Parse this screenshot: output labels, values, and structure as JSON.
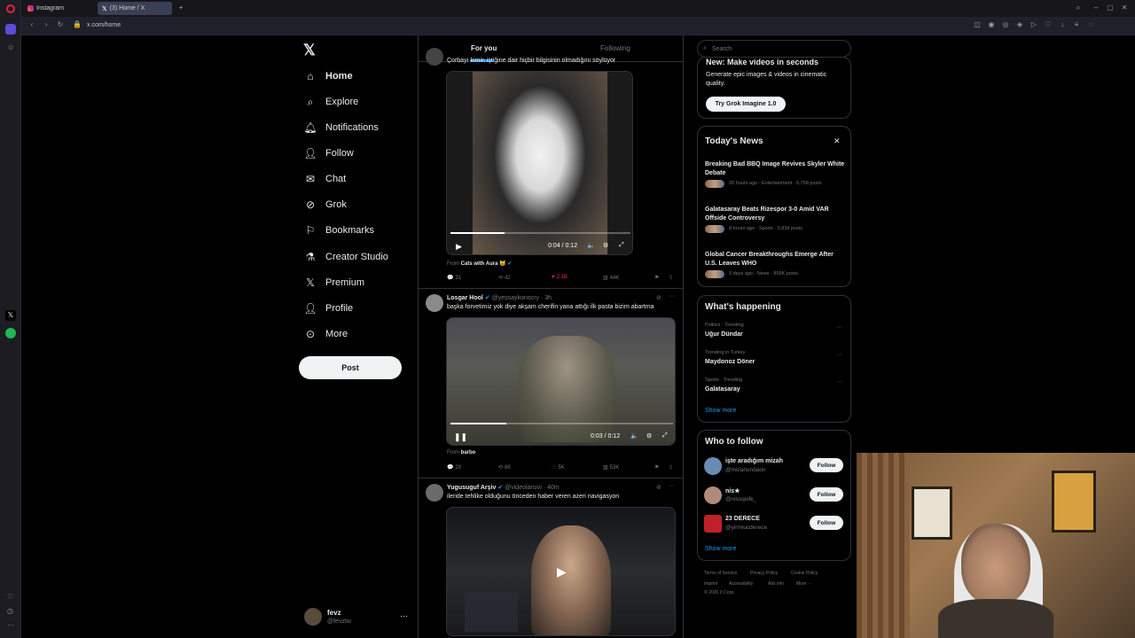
{
  "browser": {
    "tabs": [
      {
        "label": "Instagram"
      },
      {
        "label": "(3) Home / X"
      }
    ],
    "url": "x.com/home"
  },
  "nav": {
    "items": [
      {
        "label": "Home",
        "icon": "home-icon"
      },
      {
        "label": "Explore",
        "icon": "search-icon"
      },
      {
        "label": "Notifications",
        "icon": "bell-icon"
      },
      {
        "label": "Follow",
        "icon": "person-plus-icon"
      },
      {
        "label": "Chat",
        "icon": "envelope-icon"
      },
      {
        "label": "Grok",
        "icon": "grok-icon"
      },
      {
        "label": "Bookmarks",
        "icon": "bookmark-icon"
      },
      {
        "label": "Creator Studio",
        "icon": "flask-icon"
      },
      {
        "label": "Premium",
        "icon": "x-icon"
      },
      {
        "label": "Profile",
        "icon": "person-icon"
      },
      {
        "label": "More",
        "icon": "more-circle-icon"
      }
    ],
    "post_label": "Post",
    "account": {
      "name": "fevz",
      "handle": "@fevztw"
    }
  },
  "feed": {
    "tabs": {
      "for_you": "For you",
      "following": "Following"
    },
    "post1": {
      "text": "Çorbayı kimin içtiğine dair hiçbir bilgisinin olmadığını söylüyor",
      "video_time": "0:04 / 0:12",
      "video_progress": 0.3,
      "from_label": "From",
      "from_name": "Cats with Aura 😺",
      "replies": "31",
      "reposts": "42",
      "likes": "2.1B",
      "views": "44K"
    },
    "post2": {
      "name": "Losgar Hool",
      "handle": "@yessaykonocry · 3h",
      "text": "başka forvetimiz yok diye akşam cherifin yana attığı ilk pasta bizim abartma",
      "video_time": "0:03 / 0:12",
      "video_progress": 0.25,
      "from_label": "From",
      "from_name": "barbo",
      "replies": "20",
      "reposts": "88",
      "likes": "5K",
      "views": "53K"
    },
    "post3": {
      "name": "Yugusuguf Arşiv",
      "handle": "@videolarsivi · 40m",
      "text": "ileride tehlike olduğunu önceden haber veren azeri navigasyon"
    }
  },
  "sidebar": {
    "search_placeholder": "Search",
    "promo": {
      "title": "New: Make videos in seconds",
      "body": "Generate epic images & videos in cinematic quality.",
      "button": "Try Grok Imagine 1.0"
    },
    "news": {
      "title": "Today's News",
      "items": [
        {
          "headline": "Breaking Bad BBQ Image Revives Skyler White Debate",
          "meta": "20 hours ago · Entertainment · 5,758 posts"
        },
        {
          "headline": "Galatasaray Beats Rizespor 3-0 Amid VAR Offside Controversy",
          "meta": "8 hours ago · Sports · 5,834 posts"
        },
        {
          "headline": "Global Cancer Breakthroughs Emerge After U.S. Leaves WHO",
          "meta": "3 days ago · News · 855K posts"
        }
      ]
    },
    "happening": {
      "title": "What's happening",
      "items": [
        {
          "context": "Politics · Trending",
          "topic": "Uğur Dündar"
        },
        {
          "context": "Trending in Turkey",
          "topic": "Maydonoz Döner"
        },
        {
          "context": "Sports · Trending",
          "topic": "Galatasaray"
        }
      ],
      "show_more": "Show more"
    },
    "who_to_follow": {
      "title": "Who to follow",
      "items": [
        {
          "name": "işte aradığım mizah",
          "handle": "@mizahondaon",
          "button": "Follow"
        },
        {
          "name": "nis★",
          "handle": "@nissquilk_",
          "button": "Follow"
        },
        {
          "name": "23 DERECE",
          "handle": "@yirmiucderece",
          "button": "Follow"
        }
      ],
      "show_more": "Show more"
    },
    "footer": {
      "links": [
        "Terms of Service",
        "Privacy Policy",
        "Cookie Policy",
        "Imprint",
        "Accessibility",
        "Ads info",
        "More ···"
      ],
      "copyright": "© 2026 X Corp."
    }
  },
  "colors": {
    "accent": "#1d9bf0",
    "like": "#f91880",
    "bg": "#000000",
    "border": "#2f3336"
  }
}
